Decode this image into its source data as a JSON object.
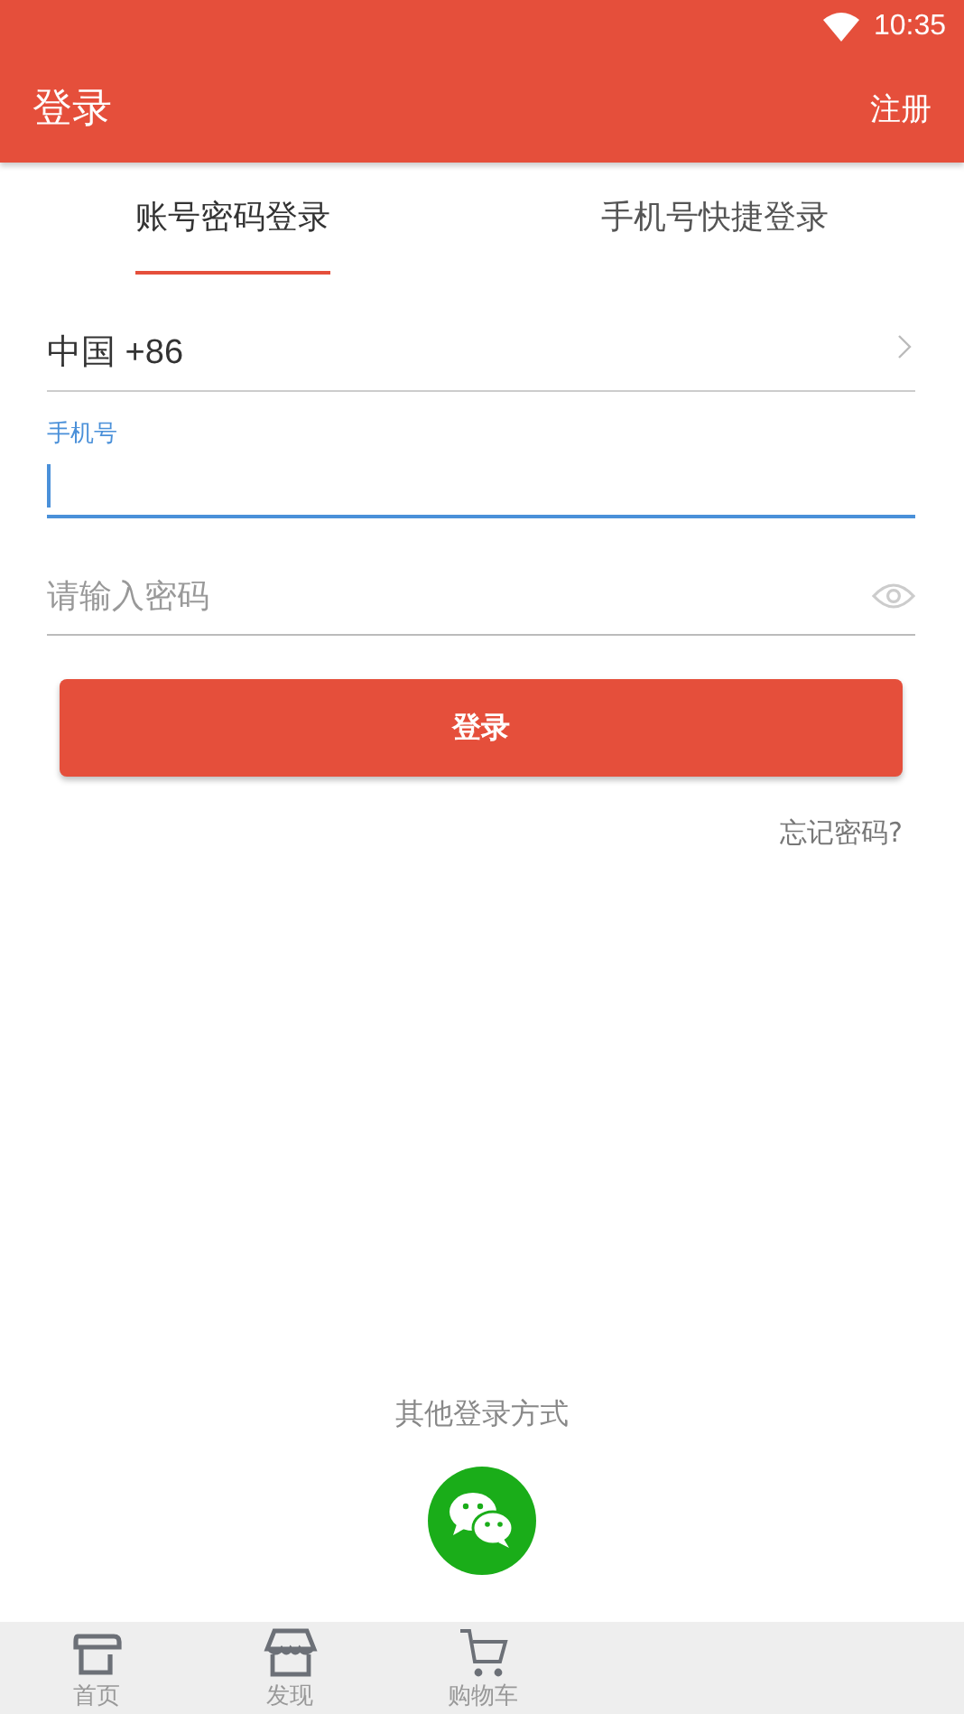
{
  "status_bar": {
    "time": "10:35"
  },
  "app_bar": {
    "title": "登录",
    "action": "注册"
  },
  "tabs": [
    {
      "label": "账号密码登录",
      "selected": true
    },
    {
      "label": "手机号快捷登录",
      "selected": false
    }
  ],
  "form": {
    "country": "中国 +86",
    "phone": {
      "label": "手机号",
      "focused": true
    },
    "password": {
      "placeholder": "请输入密码"
    },
    "submit": "登录",
    "forgot": "忘记密码?"
  },
  "other_login": {
    "label": "其他登录方式"
  },
  "bottom_nav": [
    {
      "label": "首页"
    },
    {
      "label": "发现"
    },
    {
      "label": "购物车"
    }
  ]
}
